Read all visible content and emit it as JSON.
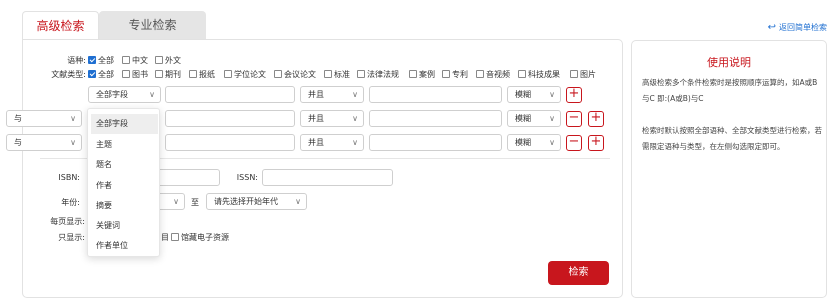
{
  "tabs": {
    "advanced": "高级检索",
    "professional": "专业检索"
  },
  "back_link": "返回简单检索",
  "language": {
    "label": "语种:",
    "options": [
      "全部",
      "中文",
      "外文"
    ],
    "checked": [
      true,
      false,
      false
    ]
  },
  "doctype": {
    "label": "文献类型:",
    "options": [
      "全部",
      "图书",
      "期刊",
      "报纸",
      "学位论文",
      "会议论文",
      "标准",
      "法律法规",
      "案例",
      "专利",
      "音视频",
      "科技成果",
      "图片"
    ],
    "checked": [
      true,
      false,
      false,
      false,
      false,
      false,
      false,
      false,
      false,
      false,
      false,
      false,
      false
    ]
  },
  "rows": {
    "field_default": "全部字段",
    "logic": "与",
    "connector": "并且",
    "match": "模糊",
    "add": "+",
    "remove": "−"
  },
  "field_options": [
    "全部字段",
    "主题",
    "题名",
    "作者",
    "摘要",
    "关键词",
    "作者单位"
  ],
  "isbn": {
    "label": "ISBN:"
  },
  "issn": {
    "label": "ISSN:"
  },
  "year": {
    "label": "年份:",
    "to": "至",
    "end_placeholder": "请先选择开始年代"
  },
  "per_page": {
    "label": "每页显示:"
  },
  "only_show": {
    "label": "只显示:",
    "partial": "目",
    "option": "馆藏电子资源"
  },
  "search_button": "检索",
  "help": {
    "title": "使用说明",
    "p1": "高级检索多个条件检索时是按照顺序运算的，如A或B与C 即:(A或B)与C",
    "p2": "检索时默认按照全部语种、全部文献类型进行检索，若需限定语种与类型，在左侧勾选限定即可。"
  }
}
